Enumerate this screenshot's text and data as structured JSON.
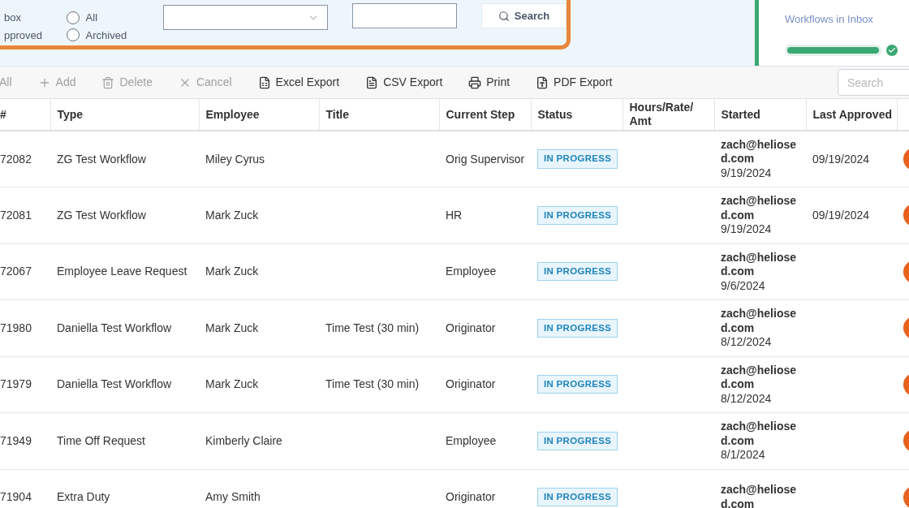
{
  "filter": {
    "radios": [
      {
        "label": "box",
        "kind": "text"
      },
      {
        "label": "All",
        "kind": "radio",
        "selected": false
      },
      {
        "label": "pproved",
        "kind": "text"
      },
      {
        "label": "Archived",
        "kind": "radio",
        "selected": false
      }
    ],
    "search_button": "Search"
  },
  "summary": {
    "label": "Workflows in Inbox",
    "level": 1
  },
  "toolbar": {
    "items": [
      {
        "label": "All",
        "disabled": true
      },
      {
        "label": "Add",
        "disabled": true
      },
      {
        "label": "Delete",
        "disabled": true
      },
      {
        "label": "Cancel",
        "disabled": true
      },
      {
        "label": "Excel Export",
        "disabled": false
      },
      {
        "label": "CSV Export",
        "disabled": false
      },
      {
        "label": "Print",
        "disabled": false
      },
      {
        "label": "PDF Export",
        "disabled": false
      }
    ],
    "search": {
      "placeholder": "Search"
    }
  },
  "table": {
    "columns": [
      "#",
      "Type",
      "Employee",
      "Title",
      "Current Step",
      "Status",
      "Hours/Rate/ Amt",
      "Started",
      "Last Approved"
    ],
    "rows": [
      {
        "id": "72082",
        "type": "ZG Test Workflow",
        "employee": "Miley Cyrus",
        "title": "",
        "step": "Orig Supervisor",
        "status": "IN PROGRESS",
        "started_by": "zach@heliosed.com",
        "started": "9/19/2024",
        "last_approved": "09/19/2024"
      },
      {
        "id": "72081",
        "type": "ZG Test Workflow",
        "employee": "Mark Zuck",
        "title": "",
        "step": "HR",
        "status": "IN PROGRESS",
        "started_by": "zach@heliosed.com",
        "started": "9/19/2024",
        "last_approved": "09/19/2024"
      },
      {
        "id": "72067",
        "type": "Employee Leave Request",
        "employee": "Mark Zuck",
        "title": "",
        "step": "Employee",
        "status": "IN PROGRESS",
        "started_by": "zach@heliosed.com",
        "started": "9/6/2024",
        "last_approved": ""
      },
      {
        "id": "71980",
        "type": "Daniella Test Workflow",
        "employee": "Mark Zuck",
        "title": "Time Test (30 min)",
        "step": "Originator",
        "status": "IN PROGRESS",
        "started_by": "zach@heliosed.com",
        "started": "8/12/2024",
        "last_approved": ""
      },
      {
        "id": "71979",
        "type": "Daniella Test Workflow",
        "employee": "Mark Zuck",
        "title": "Time Test (30 min)",
        "step": "Originator",
        "status": "IN PROGRESS",
        "started_by": "zach@heliosed.com",
        "started": "8/12/2024",
        "last_approved": ""
      },
      {
        "id": "71949",
        "type": "Time Off Request",
        "employee": "Kimberly Claire",
        "title": "",
        "step": "Employee",
        "status": "IN PROGRESS",
        "started_by": "zach@heliosed.com",
        "started": "8/1/2024",
        "last_approved": ""
      },
      {
        "id": "71904",
        "type": "Extra Duty",
        "employee": "Amy Smith",
        "title": "",
        "step": "Originator",
        "status": "IN PROGRESS",
        "started_by": "zach@heliosed.com",
        "started": "",
        "last_approved": ""
      }
    ]
  }
}
